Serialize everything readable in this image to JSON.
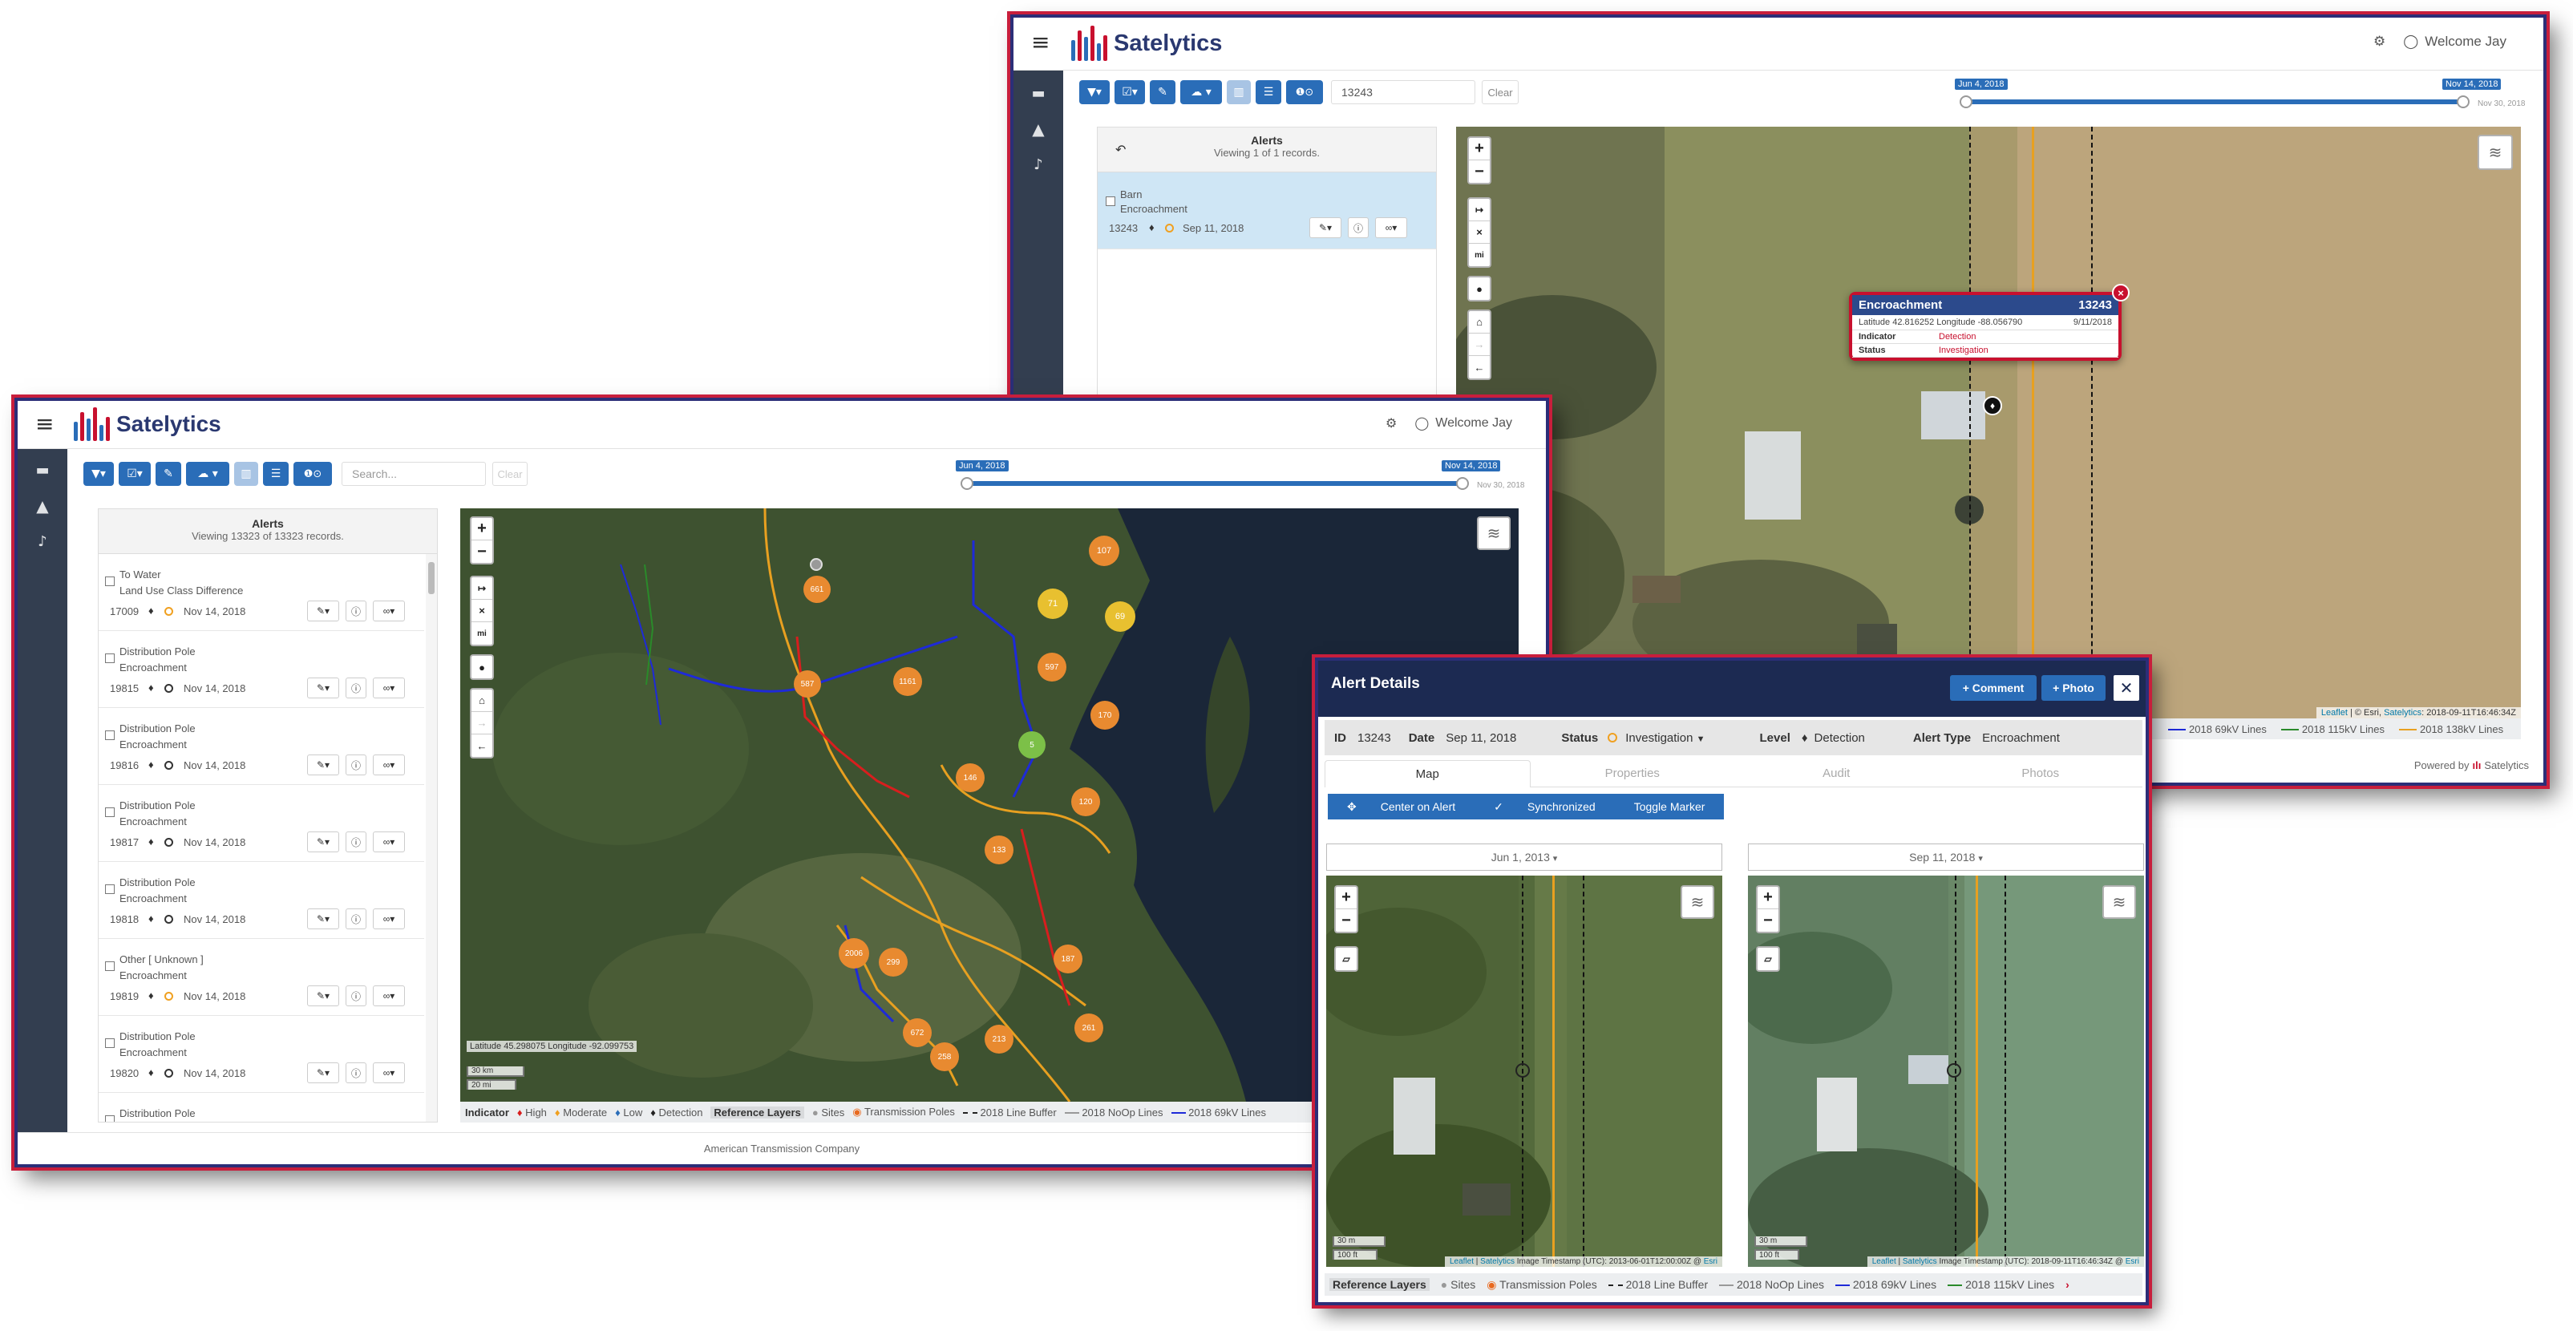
{
  "app": {
    "brand": "Satelytics",
    "welcome": "Welcome Jay",
    "powered_by": "Powered by",
    "footer": "American Transmission Company"
  },
  "colors": {
    "primary": "#2a6db8",
    "navy": "#2c2e78",
    "accent_red": "#c81e3c",
    "sidebar": "#333e50"
  },
  "back_window": {
    "search_value": "13243",
    "clear_label": "Clear",
    "slider": {
      "start_label": "Jun 4, 2018",
      "end_label": "Nov 14, 2018",
      "end_sub": "Nov 30, 2018"
    },
    "alerts": {
      "title": "Alerts",
      "subtitle": "Viewing 1 of 1 records.",
      "items": [
        {
          "line1": "Barn",
          "line2": "Encroachment",
          "id": "13243",
          "date": "Sep 11, 2018"
        }
      ]
    },
    "popup": {
      "title": "Encroachment",
      "id": "13243",
      "coords": "Latitude 42.816252 Longitude -88.056790",
      "date": "9/11/2018",
      "rows": [
        {
          "key": "Indicator",
          "value": "Detection"
        },
        {
          "key": "Status",
          "value": "Investigation"
        }
      ]
    },
    "attribution": {
      "leaflet": "Leaflet",
      "rest": " | © Esri, ",
      "sat": "Satelytics",
      "stamp": ": 2018-09-11T16:46:34Z"
    },
    "legend": [
      "2018 69kV Lines",
      "2018 115kV Lines",
      "2018 138kV Lines"
    ]
  },
  "front_window": {
    "search_placeholder": "Search...",
    "clear_label": "Clear",
    "slider": {
      "start_label": "Jun 4, 2018",
      "end_label": "Nov 14, 2018",
      "end_sub": "Nov 30, 2018"
    },
    "alerts": {
      "title": "Alerts",
      "subtitle": "Viewing 13323 of 13323 records.",
      "items": [
        {
          "line1": "To Water",
          "line2": "Land Use Class Difference",
          "id": "17009",
          "date": "Nov 14, 2018",
          "ring": "#f0a020"
        },
        {
          "line1": "Distribution Pole",
          "line2": "Encroachment",
          "id": "19815",
          "date": "Nov 14, 2018",
          "ring": "#333"
        },
        {
          "line1": "Distribution Pole",
          "line2": "Encroachment",
          "id": "19816",
          "date": "Nov 14, 2018",
          "ring": "#333"
        },
        {
          "line1": "Distribution Pole",
          "line2": "Encroachment",
          "id": "19817",
          "date": "Nov 14, 2018",
          "ring": "#333"
        },
        {
          "line1": "Distribution Pole",
          "line2": "Encroachment",
          "id": "19818",
          "date": "Nov 14, 2018",
          "ring": "#333"
        },
        {
          "line1": "Other [ Unknown ]",
          "line2": "Encroachment",
          "id": "19819",
          "date": "Nov 14, 2018",
          "ring": "#f0a020"
        },
        {
          "line1": "Distribution Pole",
          "line2": "Encroachment",
          "id": "19820",
          "date": "Nov 14, 2018",
          "ring": "#333"
        },
        {
          "line1": "Distribution Pole",
          "line2": "",
          "id": "",
          "date": "",
          "ring": "#333"
        }
      ]
    },
    "map": {
      "coords": "Latitude 45.298075 Longitude -92.099753",
      "scale_km": "30 km",
      "scale_mi": "20 mi",
      "clusters": [
        {
          "label": "107",
          "color": "#e88a30"
        },
        {
          "label": "71",
          "color": "#e8c030"
        },
        {
          "label": "69",
          "color": "#e8c030"
        },
        {
          "label": "661",
          "color": "#e88a30"
        },
        {
          "label": "587",
          "color": "#e88a30"
        },
        {
          "label": "1161",
          "color": "#e88a30"
        },
        {
          "label": "597",
          "color": "#e88a30"
        },
        {
          "label": "170",
          "color": "#e88a30"
        },
        {
          "label": "5",
          "color": "#7cc048"
        },
        {
          "label": "146",
          "color": "#e88a30"
        },
        {
          "label": "120",
          "color": "#e88a30"
        },
        {
          "label": "133",
          "color": "#e88a30"
        },
        {
          "label": "2006",
          "color": "#e88a30"
        },
        {
          "label": "299",
          "color": "#e88a30"
        },
        {
          "label": "187",
          "color": "#e88a30"
        },
        {
          "label": "672",
          "color": "#e88a30"
        },
        {
          "label": "213",
          "color": "#e88a30"
        },
        {
          "label": "258",
          "color": "#e88a30"
        },
        {
          "label": "261",
          "color": "#e88a30"
        }
      ]
    },
    "legend": {
      "indicator": "Indicator",
      "high": "High",
      "moderate": "Moderate",
      "low": "Low",
      "detection": "Detection",
      "ref": "Reference Layers",
      "sites": "Sites",
      "poles": "Transmission Poles",
      "buffer": "2018 Line Buffer",
      "noop": "2018 NoOp Lines",
      "kv69": "2018 69kV Lines"
    }
  },
  "dialog": {
    "title": "Alert Details",
    "comment_btn": "+ Comment",
    "photo_btn": "+ Photo",
    "info": {
      "id_label": "ID",
      "id": "13243",
      "date_label": "Date",
      "date": "Sep 11, 2018",
      "status_label": "Status",
      "status": "Investigation",
      "level_label": "Level",
      "level": "Detection",
      "type_label": "Alert Type",
      "type": "Encroachment"
    },
    "tabs": [
      "Map",
      "Properties",
      "Audit",
      "Photos"
    ],
    "controls": [
      "Center on Alert",
      "Synchronized",
      "Toggle Marker"
    ],
    "left_date": "Jun 1, 2013",
    "right_date": "Sep 11, 2018",
    "left_attrib": {
      "leaflet": "Leaflet",
      "sat": "Satelytics",
      "stamp": " Image Timestamp (UTC): 2013-06-01T12:00:00Z",
      "esri": "Esri"
    },
    "right_attrib": {
      "leaflet": "Leaflet",
      "sat": "Satelytics",
      "stamp": " Image Timestamp (UTC): 2018-09-11T16:46:34Z",
      "esri": "Esri"
    },
    "scale_m": "30 m",
    "scale_ft": "100 ft",
    "legend": {
      "ref": "Reference Layers",
      "sites": "Sites",
      "poles": "Transmission Poles",
      "buffer": "2018 Line Buffer",
      "noop": "2018 NoOp Lines",
      "kv69": "2018 69kV Lines",
      "kv115": "2018 115kV Lines"
    }
  }
}
